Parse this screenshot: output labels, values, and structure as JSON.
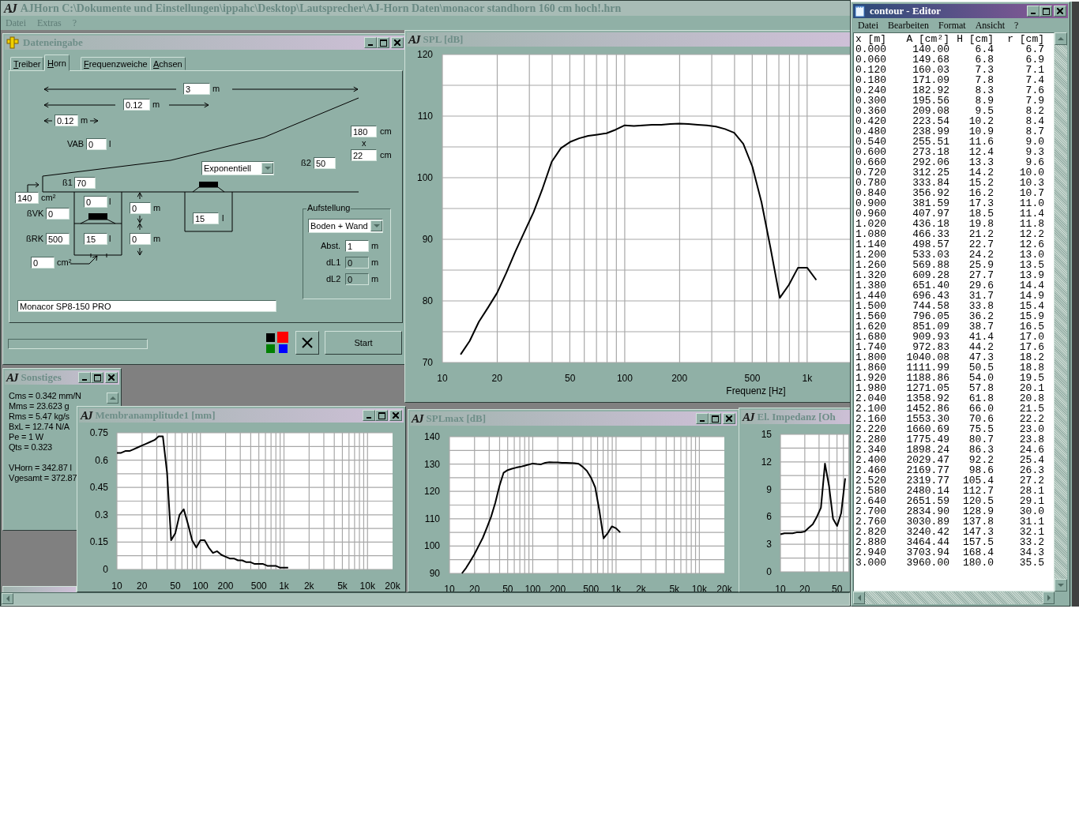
{
  "app": {
    "logo": "AJ",
    "title": "AJHorn  C:\\Dokumente und Einstellungen\\ippahc\\Desktop\\Lautsprecher\\AJ-Horn Daten\\monacor standhorn 160 cm hoch!.hrn",
    "menu": [
      "Datei",
      "Extras",
      "?"
    ]
  },
  "input_window": {
    "title": "Dateneingabe",
    "tabs": [
      {
        "label": "Treiber",
        "selected": false
      },
      {
        "label": "Horn",
        "selected": true
      },
      {
        "label": "Frequenzweiche",
        "selected": false
      },
      {
        "label": "Achsen",
        "selected": false
      }
    ],
    "fields": [
      {
        "value": "3",
        "unit": "m"
      },
      {
        "value": "0.12",
        "unit": "m"
      },
      {
        "value": "0.12",
        "unit": "m"
      },
      {
        "label": "VAB",
        "value": "0",
        "unit": "l"
      },
      {
        "value": "180",
        "unit": "cm"
      },
      {
        "value": "22",
        "unit": "cm"
      },
      {
        "label": "ß2",
        "value": "50"
      },
      {
        "label": "ß1",
        "value": "70"
      },
      {
        "value": "140",
        "unit": "cm²"
      },
      {
        "label": "ßVK",
        "value": "0"
      },
      {
        "label": "ßRK",
        "value": "500"
      },
      {
        "value": "0",
        "unit": "cm²"
      },
      {
        "value": "0",
        "unit": "l"
      },
      {
        "value": "15",
        "unit": "l"
      },
      {
        "value": "0",
        "unit": "m"
      },
      {
        "value": "0",
        "unit": "m"
      },
      {
        "value": "15",
        "unit": "l"
      }
    ],
    "size_separator": "x",
    "profile": {
      "value": "Exponentiell"
    },
    "placement": {
      "title": "Aufstellung",
      "value": "Boden + Wand",
      "fields": [
        {
          "label": "Abst.",
          "value": "1",
          "unit": "m",
          "disabled": false
        },
        {
          "label": "dL1",
          "value": "0",
          "unit": "m",
          "disabled": true
        },
        {
          "label": "dL2",
          "value": "0",
          "unit": "m",
          "disabled": true
        }
      ]
    },
    "driver": {
      "value": "Monacor SP8-150 PRO"
    },
    "progress": {
      "level": 0
    },
    "colors": [
      {
        "color": "#000000",
        "selected": false
      },
      {
        "color": "#ff0000",
        "selected": true
      },
      {
        "color": "#008000",
        "selected": false
      },
      {
        "color": "#0000ff",
        "selected": false
      }
    ],
    "buttons": [
      {
        "kind": "cancel"
      },
      {
        "kind": "start",
        "label": "Start"
      }
    ]
  },
  "spl_window": {
    "logo": "AJ",
    "title": "SPL [dB]",
    "chart_data": {
      "type": "line",
      "xlabel": "Frequenz [Hz]",
      "categories": [
        "10",
        null,
        null,
        null,
        null,
        null,
        "20",
        null,
        null,
        null,
        null,
        null,
        null,
        null,
        "50",
        null,
        null,
        null,
        null,
        null,
        "100",
        null,
        null,
        null,
        null,
        null,
        "200",
        null,
        null,
        null,
        null,
        null,
        null,
        null,
        "500",
        null,
        null,
        null,
        null,
        null,
        "1k",
        null,
        null,
        null,
        null
      ],
      "series": [
        {
          "color": "#000000",
          "values": [
            null,
            null,
            71.3,
            73.5,
            76.6,
            78.9,
            81.3,
            84.5,
            88,
            91.2,
            94.4,
            98.3,
            102.6,
            104.8,
            105.8,
            106.4,
            106.8,
            107,
            107.2,
            107.8,
            108.5,
            108.4,
            108.5,
            108.6,
            108.6,
            108.7,
            108.8,
            108.7,
            108.6,
            108.5,
            108.3,
            107.9,
            107.3,
            105.5,
            101.8,
            96,
            88.5,
            80.5,
            82.6,
            85.4,
            85.4,
            83.4,
            null,
            null,
            null
          ]
        }
      ],
      "ylim": [
        70,
        120
      ],
      "yticks": [
        70,
        80,
        90,
        100,
        110,
        120
      ],
      "grid": true
    }
  },
  "misc_window": {
    "logo": "AJ",
    "title": "Sonstiges",
    "lines": [
      "Cms = 0.342 mm/N",
      "Mms = 23.623 g",
      "Rms = 5.47 kg/s",
      "BxL = 12.74 N/A",
      "Pe = 1 W",
      "Qts = 0.323"
    ],
    "volume_lines": [
      "VHorn = 342.87 l",
      "Vgesamt = 372.87"
    ]
  },
  "amplitude_window": {
    "logo": "AJ",
    "title": "Membranamplitude1 [mm]",
    "chart_data": {
      "type": "line",
      "categories": [
        "10",
        null,
        null,
        null,
        null,
        null,
        "20",
        null,
        null,
        null,
        null,
        null,
        null,
        null,
        "50",
        null,
        null,
        null,
        null,
        null,
        "100",
        null,
        null,
        null,
        null,
        null,
        "200",
        null,
        null,
        null,
        null,
        null,
        null,
        null,
        "500",
        null,
        null,
        null,
        null,
        null,
        "1k",
        null,
        null,
        null,
        null,
        null,
        "2k",
        null,
        null,
        null,
        null,
        null,
        null,
        null,
        "5k",
        null,
        null,
        null,
        null,
        null,
        "10k",
        null,
        null,
        null,
        null,
        null,
        "20k"
      ],
      "series": [
        {
          "color": "#000000",
          "values": [
            0.64,
            0.64,
            0.65,
            0.65,
            0.66,
            0.67,
            0.68,
            0.69,
            0.7,
            0.71,
            0.73,
            0.73,
            0.53,
            0.16,
            0.2,
            0.3,
            0.33,
            0.25,
            0.16,
            0.12,
            0.16,
            0.16,
            0.12,
            0.09,
            0.1,
            0.08,
            0.07,
            0.06,
            0.06,
            0.05,
            0.05,
            0.04,
            0.04,
            0.03,
            0.03,
            0.03,
            0.02,
            0.02,
            0.02,
            0.01,
            0.01,
            0.01,
            null,
            null,
            null,
            null,
            null,
            null,
            null,
            null,
            null,
            null,
            null,
            null,
            null,
            null,
            null,
            null,
            null,
            null,
            null,
            null,
            null,
            null,
            null,
            null,
            null
          ]
        }
      ],
      "ylim": [
        0,
        0.75
      ],
      "yticks": [
        0,
        0.15,
        0.3,
        0.45,
        0.6,
        0.75
      ],
      "grid": true
    }
  },
  "splmax_window": {
    "logo": "AJ",
    "title": "SPLmax [dB]",
    "chart_data": {
      "type": "line",
      "categories": [
        "10",
        null,
        null,
        null,
        null,
        null,
        "20",
        null,
        null,
        null,
        null,
        null,
        null,
        null,
        "50",
        null,
        null,
        null,
        null,
        null,
        "100",
        null,
        null,
        null,
        null,
        null,
        "200",
        null,
        null,
        null,
        null,
        null,
        null,
        null,
        "500",
        null,
        null,
        null,
        null,
        null,
        "1k",
        null,
        null,
        null,
        null,
        null,
        "2k",
        null,
        null,
        null,
        null,
        null,
        null,
        null,
        "5k",
        null,
        null,
        null,
        null,
        null,
        "10k",
        null,
        null,
        null,
        null,
        null,
        "20k"
      ],
      "series": [
        {
          "color": "#000000",
          "values": [
            null,
            null,
            null,
            90,
            92,
            94.5,
            97,
            100,
            103,
            106.8,
            110.7,
            115.8,
            122,
            126.8,
            127.8,
            128.3,
            128.7,
            129,
            129.4,
            129.8,
            130.2,
            130,
            129.9,
            130.5,
            130.7,
            130.6,
            130.6,
            130.5,
            130.5,
            130.4,
            130.3,
            130.1,
            129,
            127.5,
            125,
            121.5,
            113,
            102.8,
            104.7,
            107.2,
            106.5,
            105,
            null,
            null,
            null,
            null,
            null,
            null,
            null,
            null,
            null,
            null,
            null,
            null,
            null,
            null,
            null,
            null,
            null,
            null,
            null,
            null,
            null,
            null,
            null,
            null,
            null
          ]
        }
      ],
      "ylim": [
        90,
        140
      ],
      "yticks": [
        90,
        100,
        110,
        120,
        130,
        140
      ],
      "grid": true
    }
  },
  "impedance_window": {
    "logo": "AJ",
    "title": "El. Impedanz [Oh",
    "chart_data": {
      "type": "line",
      "categories": [
        "10",
        null,
        null,
        null,
        null,
        null,
        "20",
        null,
        null,
        null,
        null,
        null,
        null,
        null,
        "50",
        null,
        null
      ],
      "series": [
        {
          "color": "#000000",
          "values": [
            4.1,
            4.2,
            4.2,
            4.2,
            4.3,
            4.3,
            4.4,
            4.8,
            5.2,
            6,
            7,
            11.8,
            9.4,
            5.8,
            5,
            6.4,
            10.2
          ]
        }
      ],
      "ylim": [
        0,
        15
      ],
      "yticks": [
        0,
        3,
        6,
        9,
        12,
        15
      ],
      "grid": true
    }
  },
  "editor": {
    "title": "contour - Editor",
    "menu": [
      "Datei",
      "Bearbeiten",
      "Format",
      "Ansicht",
      "?"
    ],
    "columns": [
      "x [m]",
      "A [cm²]",
      "H [cm]",
      "r [cm]"
    ],
    "rows": [
      [
        "0.000",
        "140.00",
        "6.4",
        "6.7"
      ],
      [
        "0.060",
        "149.68",
        "6.8",
        "6.9"
      ],
      [
        "0.120",
        "160.03",
        "7.3",
        "7.1"
      ],
      [
        "0.180",
        "171.09",
        "7.8",
        "7.4"
      ],
      [
        "0.240",
        "182.92",
        "8.3",
        "7.6"
      ],
      [
        "0.300",
        "195.56",
        "8.9",
        "7.9"
      ],
      [
        "0.360",
        "209.08",
        "9.5",
        "8.2"
      ],
      [
        "0.420",
        "223.54",
        "10.2",
        "8.4"
      ],
      [
        "0.480",
        "238.99",
        "10.9",
        "8.7"
      ],
      [
        "0.540",
        "255.51",
        "11.6",
        "9.0"
      ],
      [
        "0.600",
        "273.18",
        "12.4",
        "9.3"
      ],
      [
        "0.660",
        "292.06",
        "13.3",
        "9.6"
      ],
      [
        "0.720",
        "312.25",
        "14.2",
        "10.0"
      ],
      [
        "0.780",
        "333.84",
        "15.2",
        "10.3"
      ],
      [
        "0.840",
        "356.92",
        "16.2",
        "10.7"
      ],
      [
        "0.900",
        "381.59",
        "17.3",
        "11.0"
      ],
      [
        "0.960",
        "407.97",
        "18.5",
        "11.4"
      ],
      [
        "1.020",
        "436.18",
        "19.8",
        "11.8"
      ],
      [
        "1.080",
        "466.33",
        "21.2",
        "12.2"
      ],
      [
        "1.140",
        "498.57",
        "22.7",
        "12.6"
      ],
      [
        "1.200",
        "533.03",
        "24.2",
        "13.0"
      ],
      [
        "1.260",
        "569.88",
        "25.9",
        "13.5"
      ],
      [
        "1.320",
        "609.28",
        "27.7",
        "13.9"
      ],
      [
        "1.380",
        "651.40",
        "29.6",
        "14.4"
      ],
      [
        "1.440",
        "696.43",
        "31.7",
        "14.9"
      ],
      [
        "1.500",
        "744.58",
        "33.8",
        "15.4"
      ],
      [
        "1.560",
        "796.05",
        "36.2",
        "15.9"
      ],
      [
        "1.620",
        "851.09",
        "38.7",
        "16.5"
      ],
      [
        "1.680",
        "909.93",
        "41.4",
        "17.0"
      ],
      [
        "1.740",
        "972.83",
        "44.2",
        "17.6"
      ],
      [
        "1.800",
        "1040.08",
        "47.3",
        "18.2"
      ],
      [
        "1.860",
        "1111.99",
        "50.5",
        "18.8"
      ],
      [
        "1.920",
        "1188.86",
        "54.0",
        "19.5"
      ],
      [
        "1.980",
        "1271.05",
        "57.8",
        "20.1"
      ],
      [
        "2.040",
        "1358.92",
        "61.8",
        "20.8"
      ],
      [
        "2.100",
        "1452.86",
        "66.0",
        "21.5"
      ],
      [
        "2.160",
        "1553.30",
        "70.6",
        "22.2"
      ],
      [
        "2.220",
        "1660.69",
        "75.5",
        "23.0"
      ],
      [
        "2.280",
        "1775.49",
        "80.7",
        "23.8"
      ],
      [
        "2.340",
        "1898.24",
        "86.3",
        "24.6"
      ],
      [
        "2.400",
        "2029.47",
        "92.2",
        "25.4"
      ],
      [
        "2.460",
        "2169.77",
        "98.6",
        "26.3"
      ],
      [
        "2.520",
        "2319.77",
        "105.4",
        "27.2"
      ],
      [
        "2.580",
        "2480.14",
        "112.7",
        "28.1"
      ],
      [
        "2.640",
        "2651.59",
        "120.5",
        "29.1"
      ],
      [
        "2.700",
        "2834.90",
        "128.9",
        "30.0"
      ],
      [
        "2.760",
        "3030.89",
        "137.8",
        "31.1"
      ],
      [
        "2.820",
        "3240.42",
        "147.3",
        "32.1"
      ],
      [
        "2.880",
        "3464.44",
        "157.5",
        "33.2"
      ],
      [
        "2.940",
        "3703.94",
        "168.4",
        "34.3"
      ],
      [
        "3.000",
        "3960.00",
        "180.0",
        "35.5"
      ]
    ]
  }
}
